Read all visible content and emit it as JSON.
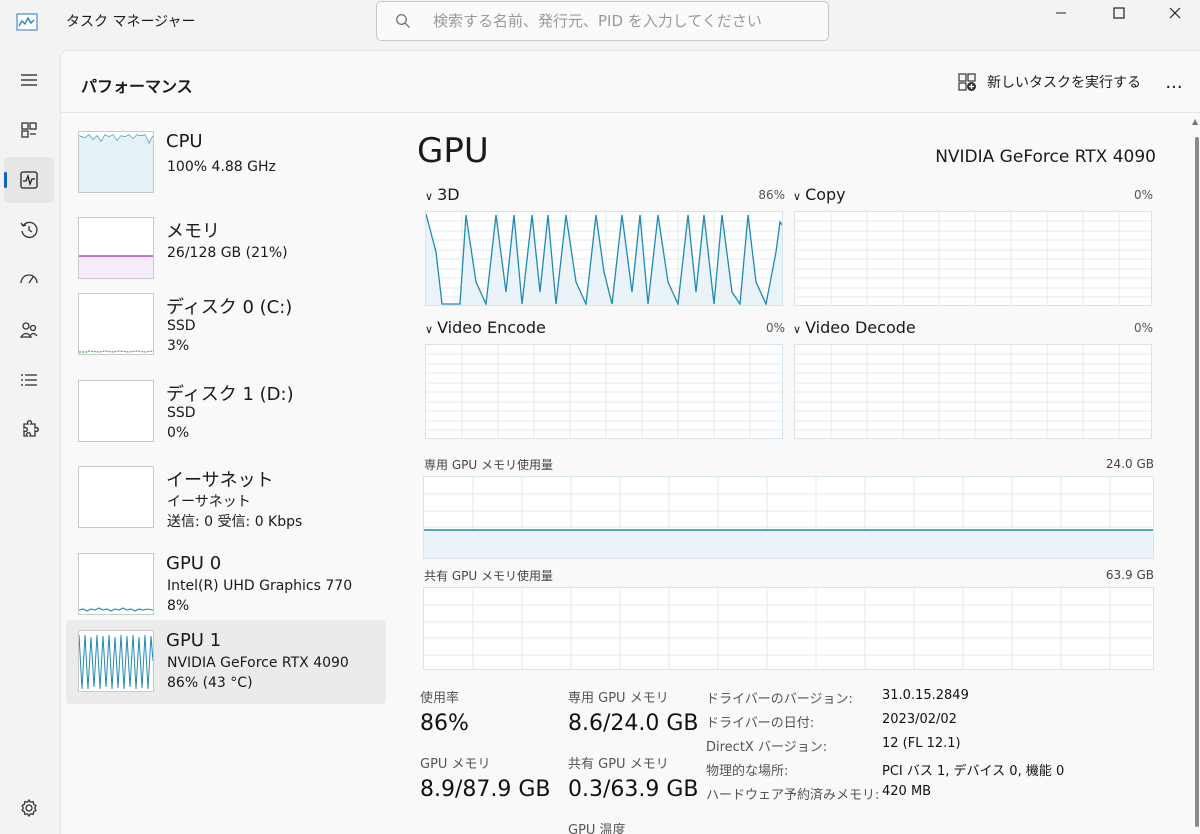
{
  "app": {
    "title": "タスク マネージャー",
    "search_placeholder": "検索する名前、発行元、PID を入力してください"
  },
  "header": {
    "title": "パフォーマンス",
    "run_task": "新しいタスクを実行する",
    "more": "..."
  },
  "devices": [
    {
      "name": "CPU",
      "line1": "100% 4.88 GHz",
      "line2": ""
    },
    {
      "name": "メモリ",
      "line1": "26/128 GB (21%)",
      "line2": ""
    },
    {
      "name": "ディスク 0 (C:)",
      "line1": "SSD",
      "line2": "3%"
    },
    {
      "name": "ディスク 1 (D:)",
      "line1": "SSD",
      "line2": "0%"
    },
    {
      "name": "イーサネット",
      "line1": "イーサネット",
      "line2": "送信: 0 受信: 0 Kbps"
    },
    {
      "name": "GPU 0",
      "line1": "Intel(R) UHD Graphics 770",
      "line2": "8%"
    },
    {
      "name": "GPU 1",
      "line1": "NVIDIA GeForce RTX 4090",
      "line2": "86% (43 °C)"
    }
  ],
  "gpu": {
    "title": "GPU",
    "model": "NVIDIA GeForce RTX 4090",
    "engines": [
      {
        "label": "3D",
        "pct": "86%"
      },
      {
        "label": "Copy",
        "pct": "0%"
      },
      {
        "label": "Video Encode",
        "pct": "0%"
      },
      {
        "label": "Video Decode",
        "pct": "0%"
      }
    ],
    "dedicated_label": "専用 GPU メモリ使用量",
    "dedicated_max": "24.0 GB",
    "shared_label": "共有 GPU メモリ使用量",
    "shared_max": "63.9 GB"
  },
  "stats": {
    "utilization_label": "使用率",
    "utilization": "86%",
    "dedicated_label": "専用 GPU メモリ",
    "dedicated": "8.6/24.0 GB",
    "gpu_mem_label": "GPU メモリ",
    "gpu_mem": "8.9/87.9 GB",
    "shared_label": "共有 GPU メモリ",
    "shared": "0.3/63.9 GB",
    "temp_label": "GPU 温度"
  },
  "info": [
    {
      "key": "ドライバーのバージョン:",
      "value": "31.0.15.2849"
    },
    {
      "key": "ドライバーの日付:",
      "value": "2023/02/02"
    },
    {
      "key": "DirectX バージョン:",
      "value": "12 (FL 12.1)"
    },
    {
      "key": "物理的な場所:",
      "value": "PCI バス 1, デバイス 0, 機能 0"
    },
    {
      "key": "ハードウェア予約済みメモリ:",
      "value": "420 MB"
    }
  ],
  "colors": {
    "gpu_line": "#1f8ab5",
    "memory_line": "#8e2ec2",
    "disk_line": "#4caf50",
    "accent": "#0a64c2"
  }
}
